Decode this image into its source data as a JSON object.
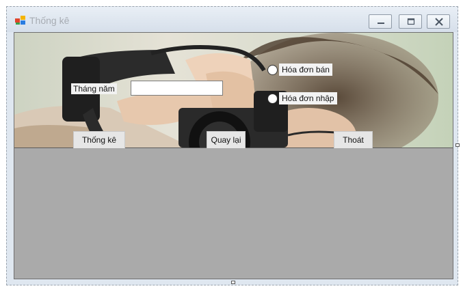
{
  "window": {
    "title": "Thống kê",
    "controls": {
      "minimize_icon": "minimize-icon",
      "maximize_icon": "maximize-icon",
      "close_icon": "close-icon"
    }
  },
  "form": {
    "month_year_label": "Tháng năm",
    "month_year_value": "",
    "radio_sales_invoice": "Hóa đơn bán",
    "radio_purchase_invoice": "Hóa đơn nhập",
    "statistics_button": "Thống kê",
    "back_button": "Quay lại",
    "exit_button": "Thoát"
  },
  "colors": {
    "title_text": "#a7acb3",
    "grid_background": "#aaaaaa",
    "titlebar": "#dfe7f0"
  }
}
